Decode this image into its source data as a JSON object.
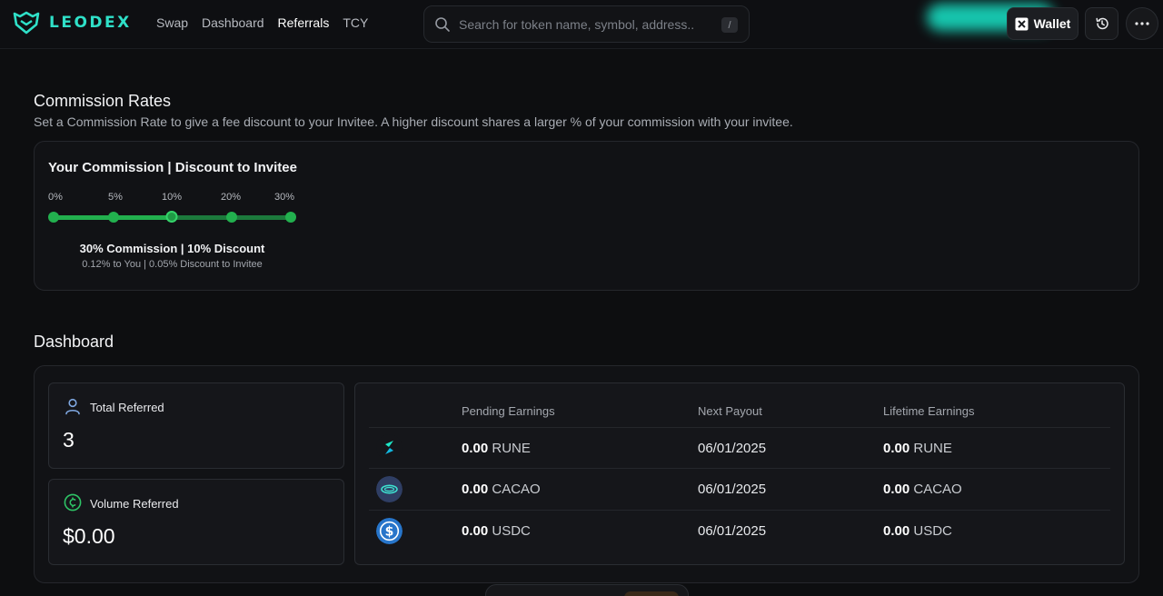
{
  "header": {
    "logo_text": "LEODEX",
    "nav": [
      "Swap",
      "Dashboard",
      "Referrals",
      "TCY"
    ],
    "active_nav": "Referrals",
    "search_placeholder": "Search for token name, symbol, address...",
    "search_shortcut": "/",
    "wallet_label": "Wallet",
    "accent_color": "#2fe0c8"
  },
  "commission": {
    "title": "Commission Rates",
    "subtitle": "Set a Commission Rate to give a fee discount to your Invitee. A higher discount shares a larger % of your commission with your invitee.",
    "heading": "Your Commission | Discount to Invitee",
    "ticks": [
      "0%",
      "5%",
      "10%",
      "20%",
      "30%"
    ],
    "selected_index": 2,
    "summary": "30% Commission | 10% Discount",
    "detail": "0.12% to You | 0.05% Discount to Invitee",
    "slider_color": "#22b04e"
  },
  "dashboard": {
    "title": "Dashboard",
    "total_referred_label": "Total Referred",
    "total_referred_value": "3",
    "volume_referred_label": "Volume Referred",
    "volume_referred_value": "$0.00",
    "columns": [
      "Pending Earnings",
      "Next Payout",
      "Lifetime Earnings"
    ],
    "rows": [
      {
        "icon": "rune-icon",
        "pending_amount": "0.00",
        "pending_unit": "RUNE",
        "next_payout": "06/01/2025",
        "lifetime_amount": "0.00",
        "lifetime_unit": "RUNE"
      },
      {
        "icon": "cacao-icon",
        "pending_amount": "0.00",
        "pending_unit": "CACAO",
        "next_payout": "06/01/2025",
        "lifetime_amount": "0.00",
        "lifetime_unit": "CACAO"
      },
      {
        "icon": "usdc-icon",
        "pending_amount": "0.00",
        "pending_unit": "USDC",
        "next_payout": "06/01/2025",
        "lifetime_amount": "0.00",
        "lifetime_unit": "USDC"
      }
    ]
  }
}
